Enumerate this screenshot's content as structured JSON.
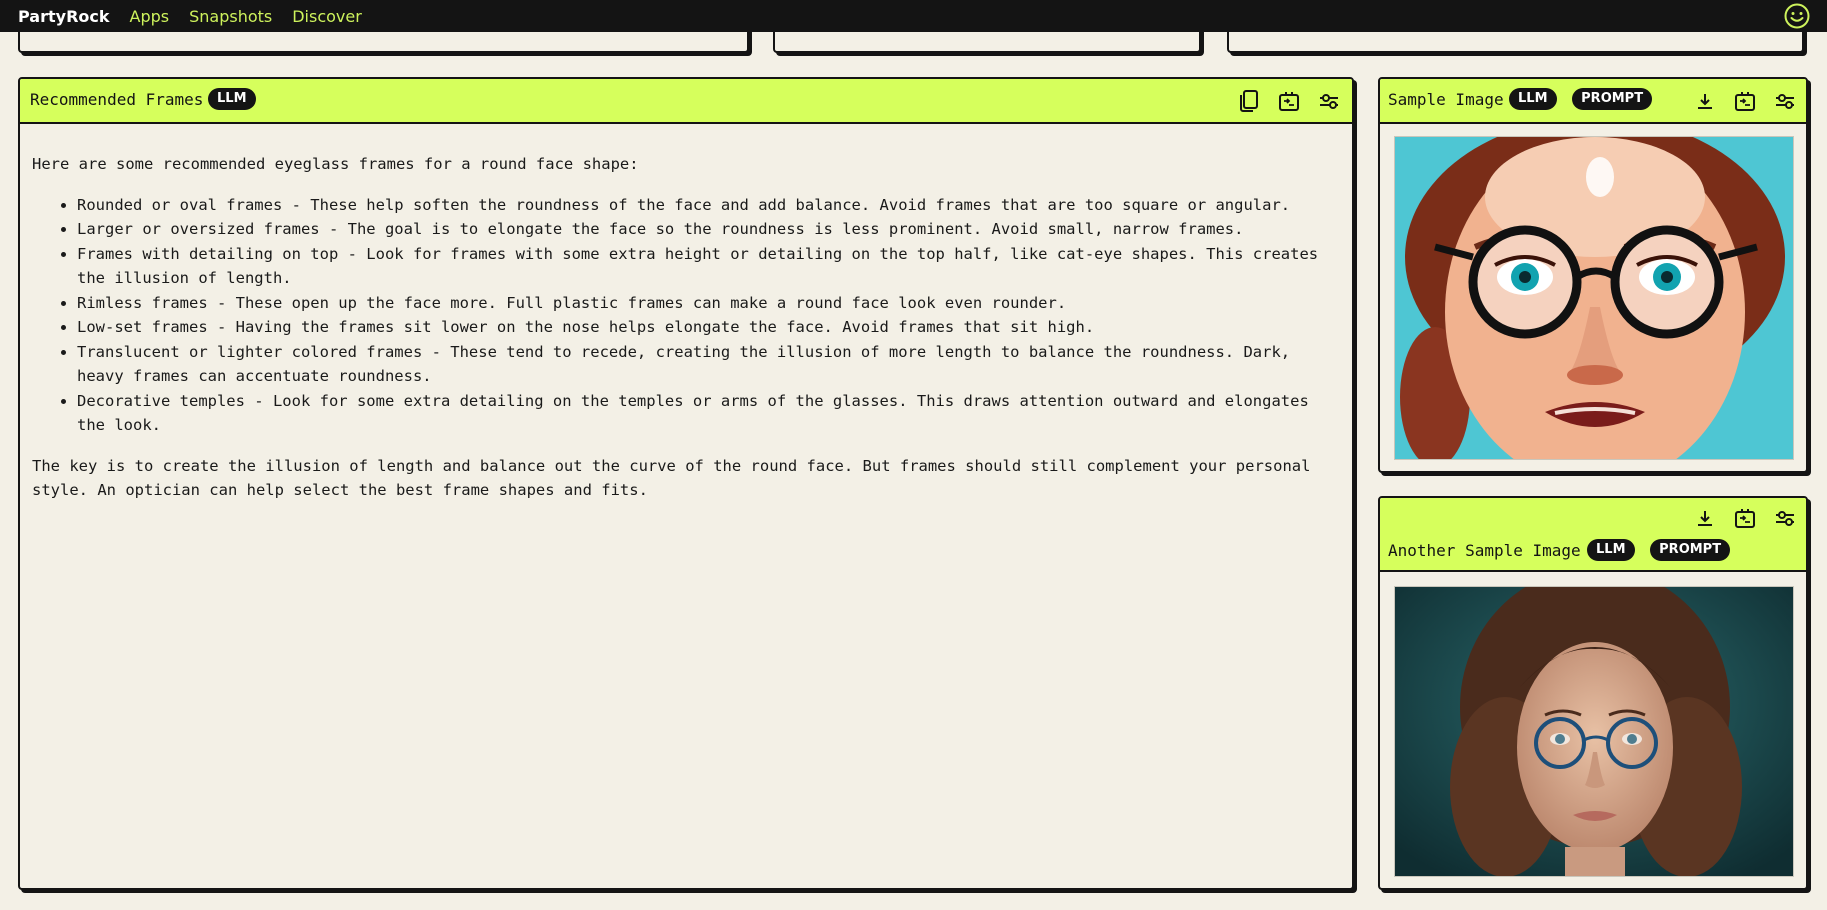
{
  "nav": {
    "brand": "PartyRock",
    "links": [
      "Apps",
      "Snapshots",
      "Discover"
    ]
  },
  "recommended": {
    "title": "Recommended Frames",
    "badge": "LLM",
    "intro": "Here are some recommended eyeglass frames for a round face shape:",
    "bullets": [
      "Rounded or oval frames - These help soften the roundness of the face and add balance. Avoid frames that are too square or angular.",
      "Larger or oversized frames - The goal is to elongate the face so the roundness is less prominent. Avoid small, narrow frames.",
      "Frames with detailing on top - Look for frames with some extra height or detailing on the top half, like cat-eye shapes. This creates the illusion of length.",
      "Rimless frames - These open up the face more. Full plastic frames can make a round face look even rounder.",
      "Low-set frames - Having the frames sit lower on the nose helps elongate the face. Avoid frames that sit high.",
      "Translucent or lighter colored frames - These tend to recede, creating the illusion of more length to balance the roundness. Dark, heavy frames can accentuate roundness.",
      "Decorative temples - Look for some extra detailing on the temples or arms of the glasses. This draws attention outward and elongates the look."
    ],
    "outro": "The key is to create the illusion of length and balance out the curve of the round face. But frames should still complement your personal style. An optician can help select the best frame shapes and fits."
  },
  "sample_image": {
    "title": "Sample Image",
    "badges": [
      "LLM",
      "PROMPT"
    ]
  },
  "another_image": {
    "title": "Another Sample Image",
    "badges": [
      "LLM",
      "PROMPT"
    ]
  },
  "colors": {
    "header_bg": "#d6ff5c",
    "nav_bg": "#141414",
    "nav_link": "#cdf25c",
    "page_bg": "#f3f0e6"
  }
}
